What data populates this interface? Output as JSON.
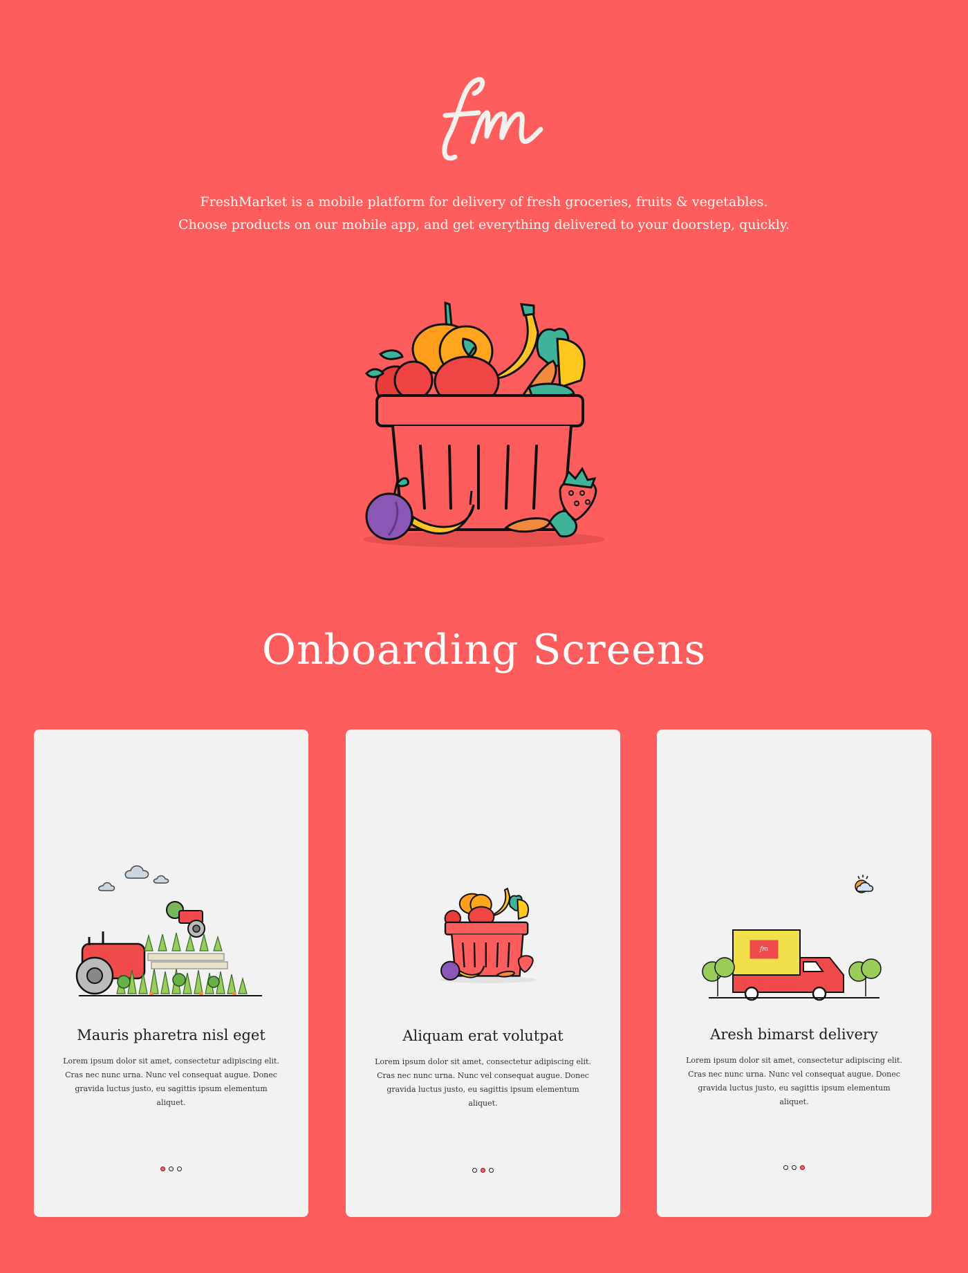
{
  "brand": {
    "logo_text": "fm"
  },
  "intro": {
    "line1": "FreshMarket is a mobile platform for delivery of fresh groceries, fruits & vegetables.",
    "line2": "Choose products on our mobile app, and get everything delivered to your doorstep, quickly."
  },
  "section": {
    "title": "Onboarding Screens"
  },
  "cards": [
    {
      "title": "Mauris pharetra nisl eget",
      "body": "Lorem ipsum dolor sit amet, consectetur adipiscing elit. Cras nec nunc urna. Nunc vel consequat augue. Donec gravida luctus justo, eu sagittis ipsum elementum aliquet.",
      "active_dot": 1,
      "illustration": "farm-tractor-icon"
    },
    {
      "title": "Aliquam erat volutpat",
      "body": "Lorem ipsum dolor sit amet, consectetur adipiscing elit. Cras nec nunc urna. Nunc vel consequat augue. Donec gravida luctus justo, eu sagittis ipsum elementum aliquet.",
      "active_dot": 2,
      "illustration": "grocery-basket-icon"
    },
    {
      "title": "Aresh bimarst delivery",
      "body": "Lorem ipsum dolor sit amet, consectetur adipiscing elit. Cras nec nunc urna. Nunc vel consequat augue. Donec gravida luctus justo, eu sagittis ipsum elementum aliquet.",
      "active_dot": 3,
      "illustration": "delivery-truck-icon"
    }
  ],
  "colors": {
    "background": "#fd5d5d",
    "card": "#f2f2f2",
    "accent": "#fd5d5d"
  }
}
